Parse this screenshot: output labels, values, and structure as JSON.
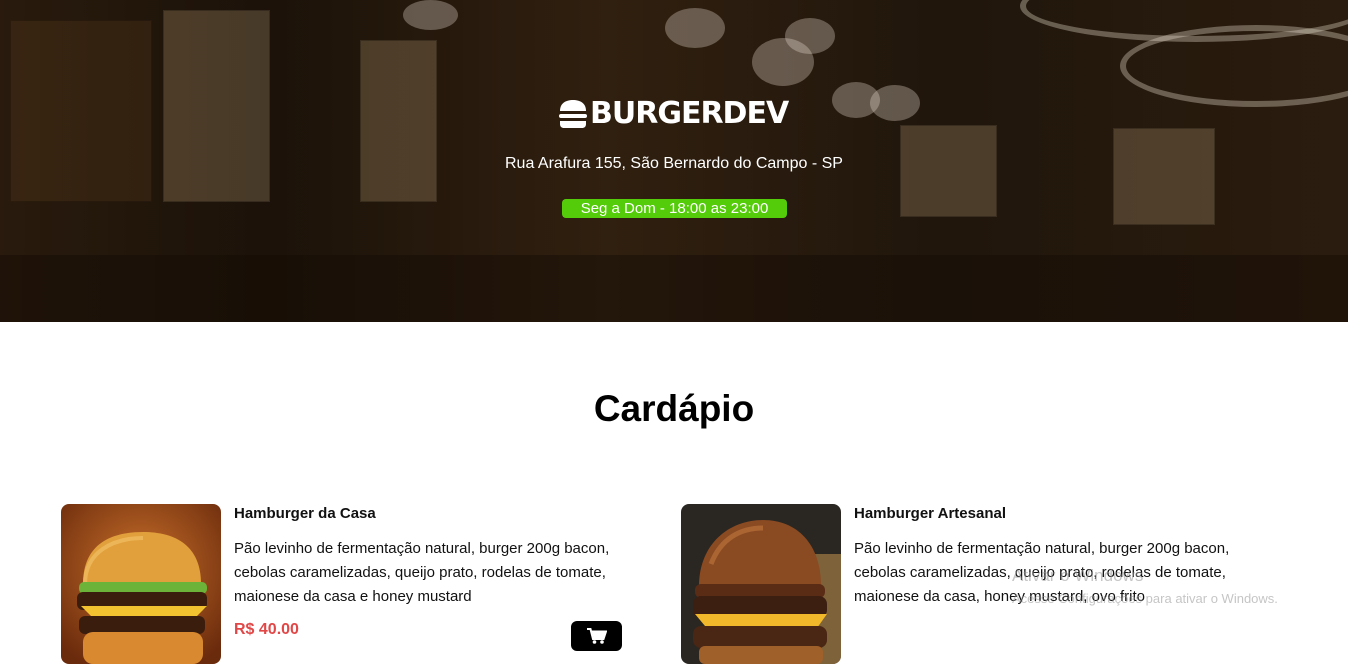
{
  "brand": {
    "name": "BURGERDEV",
    "icon": "burger-icon"
  },
  "hero": {
    "address": "Rua Arafura 155, São Bernardo do Campo - SP",
    "hours": "Seg a Dom - 18:00 as 23:00",
    "hours_color": "#54cc0a"
  },
  "menu": {
    "title": "Cardápio",
    "items": [
      {
        "name": "Hamburger da Casa",
        "description": "Pão levinho de fermentação natural, burger 200g bacon, cebolas caramelizadas, queijo prato, rodelas de tomate, maionese da casa e honey mustard",
        "price": "R$ 40.00",
        "icon": "cart-icon"
      },
      {
        "name": "Hamburger Artesanal",
        "description": "Pão levinho de fermentação natural, burger 200g bacon, cebolas caramelizadas, queijo prato, rodelas de tomate, maionese da casa, honey mustard, ovo frito",
        "icon": "cart-icon"
      }
    ]
  },
  "watermark": {
    "title": "Ativar o Windows",
    "subtitle": "Acesse Configurações para ativar o Windows."
  },
  "colors": {
    "price": "#e24747",
    "accent": "#54cc0a"
  }
}
